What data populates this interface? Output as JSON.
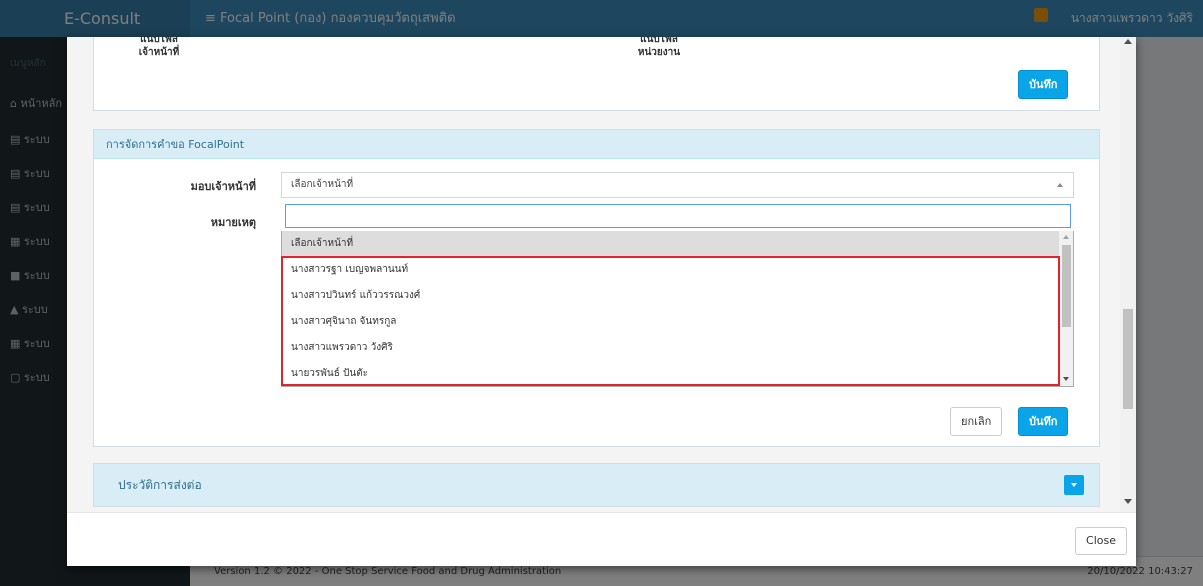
{
  "app": {
    "logo": "E-Consult",
    "nav_title": "≡  Focal Point (กอง) กองควบคุมวัตถุเสพติด",
    "user_name": "นางสาวแพรวดาว วังศิริ",
    "sidebar_section": "เมนูหลัก",
    "sidebar_items": [
      "หน้าหลัก",
      "ระบบ",
      "ระบบ",
      "ระบบ",
      "ระบบ",
      "ระบบ",
      "ระบบ",
      "ระบบ",
      "ระบบ"
    ],
    "footer_version": "Version 1.2 © 2022 - One Stop Service Food and Drug Administration",
    "footer_datetime": "20/10/2022 10:43:27"
  },
  "top_box": {
    "label_officer": "แนบไฟล์\nเจ้าหน้าที่",
    "label_unit": "แนบไฟล์\nหน่วยงาน",
    "save_label": "บันทึก"
  },
  "focal_box": {
    "header": "การจัดการคำขอ FocalPoint",
    "assign_label": "มอบเจ้าหน้าที่",
    "note_label": "หมายเหตุ",
    "select_value": "เลือกเจ้าหน้าที่",
    "search_value": "",
    "options": [
      "เลือกเจ้าหน้าที่",
      "นางสาวรฐา เบญจพลานนท์",
      "นางสาวปวินทร์ แก้ววรรณวงศ์",
      "นางสาวศุจินาถ จันทรกูล",
      "นางสาวแพรวดาว วังศิริ",
      "นายวรพันธ์ ปันตัะ"
    ],
    "cancel_label": "ยกเลิก",
    "save_label": "บันทึก"
  },
  "history_box": {
    "header": "ประวัติการส่งต่อ"
  },
  "modal": {
    "close_label": "Close"
  }
}
